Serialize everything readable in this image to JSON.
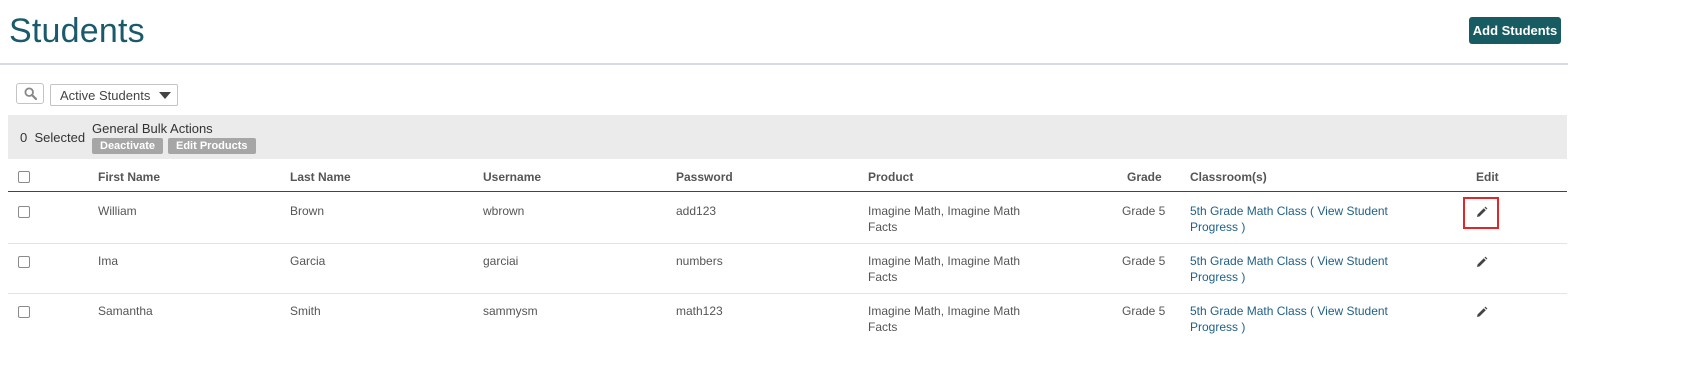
{
  "header": {
    "title": "Students",
    "add_button": "Add Students"
  },
  "filters": {
    "status_selected": "Active Students"
  },
  "bulk": {
    "count": "0",
    "selected_label": "Selected",
    "title": "General Bulk Actions",
    "deactivate": "Deactivate",
    "edit_products": "Edit Products"
  },
  "table": {
    "columns": [
      "First Name",
      "Last Name",
      "Username",
      "Password",
      "Product",
      "Grade",
      "Classroom(s)",
      "Edit"
    ],
    "rows": [
      {
        "first": "William",
        "last": "Brown",
        "username": "wbrown",
        "password": "add123",
        "product_l1": "Imagine Math, Imagine Math",
        "product_l2": "Facts",
        "grade": "Grade 5",
        "class_l1": "5th Grade Math Class ( View Student",
        "class_l2": "Progress )"
      },
      {
        "first": "Ima",
        "last": "Garcia",
        "username": "garciai",
        "password": "numbers",
        "product_l1": "Imagine Math, Imagine Math",
        "product_l2": "Facts",
        "grade": "Grade 5",
        "class_l1": "5th Grade Math Class ( View Student",
        "class_l2": "Progress )"
      },
      {
        "first": "Samantha",
        "last": "Smith",
        "username": "sammysm",
        "password": "math123",
        "product_l1": "Imagine Math, Imagine Math",
        "product_l2": "Facts",
        "grade": "Grade 5",
        "class_l1": "5th Grade Math Class ( View Student",
        "class_l2": "Progress )"
      }
    ]
  },
  "icons": {
    "search": "search-icon",
    "edit": "pencil-icon",
    "dropdown": "caret-down-icon"
  },
  "colors": {
    "title": "#1a5a6b",
    "primary_button": "#175c63",
    "link": "#1f5f87",
    "highlight": "#e0262a"
  }
}
